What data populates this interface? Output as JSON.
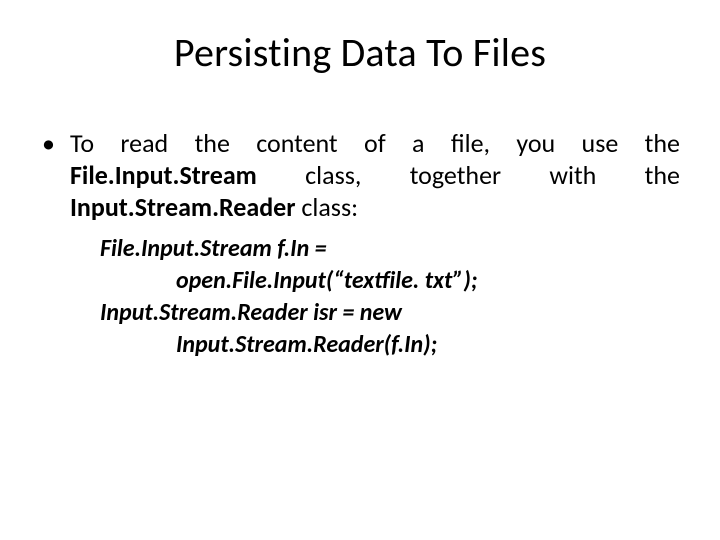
{
  "title": "Persisting Data To Files",
  "bullet": {
    "pre": "To read the content of a file, you use the ",
    "b1": "File.Input.Stream",
    "mid": " class, together with the ",
    "b2": "Input.Stream.Reader",
    "post": " class:"
  },
  "code": {
    "l1": "File.Input.Stream f.In =",
    "l2": "              open.File.Input(“textfile. txt”);",
    "l3": "Input.Stream.Reader isr = new",
    "l4": "              Input.Stream.Reader(f.In);"
  }
}
